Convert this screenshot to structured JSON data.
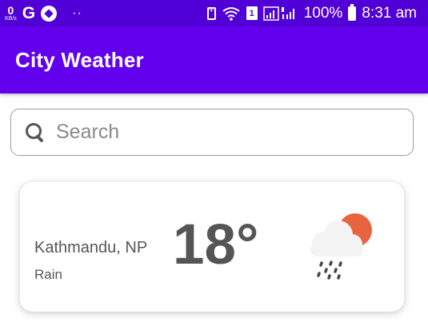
{
  "status_bar": {
    "speed_value": "0",
    "speed_unit": "KB/s",
    "g_label": "G",
    "dots": "··",
    "sim_label": "1",
    "battery_text": "100%",
    "time": "8:31 am"
  },
  "app_bar": {
    "title": "City Weather",
    "color": "#6200ee"
  },
  "search": {
    "placeholder": "Search",
    "value": ""
  },
  "weather_card": {
    "city": "Kathmandu, NP",
    "condition": "Rain",
    "temperature": "18°",
    "icon": "rain-sun-cloud-icon"
  }
}
